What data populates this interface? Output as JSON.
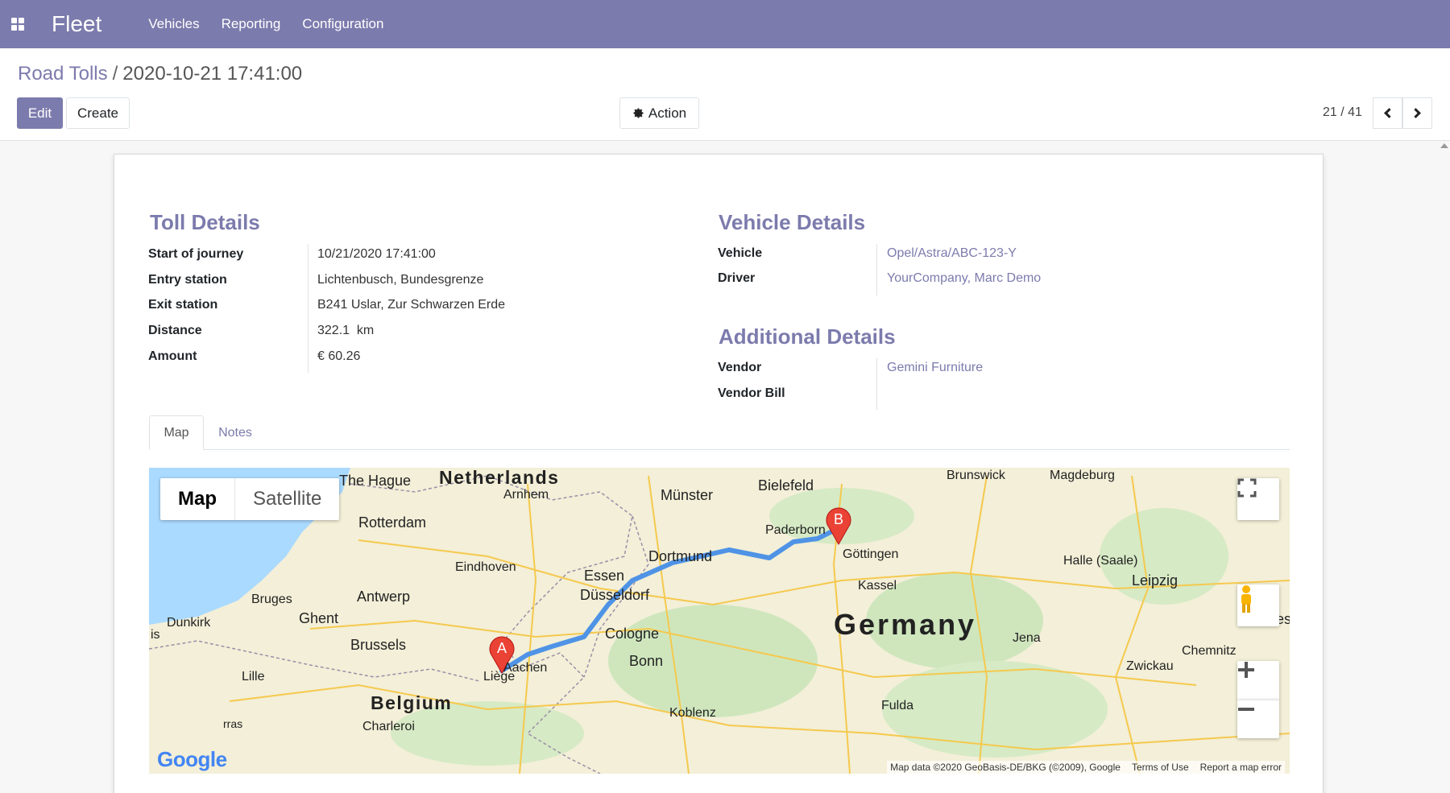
{
  "navbar": {
    "app_name": "Fleet",
    "menu": [
      "Vehicles",
      "Reporting",
      "Configuration"
    ],
    "color": "#7c7bad"
  },
  "breadcrumb": {
    "parent": "Road Tolls",
    "separator": "/",
    "current": "2020-10-21 17:41:00"
  },
  "toolbar": {
    "edit_label": "Edit",
    "create_label": "Create",
    "action_label": "Action"
  },
  "pager": {
    "value": "21 / 41"
  },
  "toll_details": {
    "title": "Toll Details",
    "fields": [
      {
        "label": "Start of journey",
        "value": "10/21/2020 17:41:00"
      },
      {
        "label": "Entry station",
        "value": "Lichtenbusch, Bundesgrenze"
      },
      {
        "label": "Exit station",
        "value": "B241 Uslar, Zur Schwarzen Erde"
      },
      {
        "label": "Distance",
        "value": "322.1  km"
      },
      {
        "label": "Amount",
        "value": "€ 60.26"
      }
    ]
  },
  "vehicle_details": {
    "title": "Vehicle Details",
    "fields": [
      {
        "label": "Vehicle",
        "value": "Opel/Astra/ABC-123-Y"
      },
      {
        "label": "Driver",
        "value": "YourCompany, Marc Demo"
      }
    ]
  },
  "additional_details": {
    "title": "Additional Details",
    "fields": [
      {
        "label": "Vendor",
        "value": "Gemini Furniture"
      },
      {
        "label": "Vendor Bill",
        "value": ""
      }
    ]
  },
  "tabs": [
    "Map",
    "Notes"
  ],
  "map": {
    "type_map": "Map",
    "type_satellite": "Satellite",
    "marker_start": "A",
    "marker_end": "B",
    "logo": "Google",
    "attribution": "Map data ©2020 GeoBasis-DE/BKG (©2009), Google",
    "terms": "Terms of Use",
    "report": "Report a map error",
    "countries": [
      "Netherlands",
      "Germany",
      "Belgium"
    ],
    "cities": [
      "The Hague",
      "Arnhem",
      "Rotterdam",
      "Münster",
      "Bielefeld",
      "Brunswick",
      "Magdeburg",
      "Paderborn",
      "Göttingen",
      "Dortmund",
      "Essen",
      "Eindhoven",
      "Düsseldorf",
      "Kassel",
      "Halle (Saale)",
      "Leipzig",
      "Bruges",
      "Antwerp",
      "Ghent",
      "Dunkirk",
      "Brussels",
      "Cologne",
      "Bonn",
      "Aachen",
      "Liège",
      "Jena",
      "Chemnitz",
      "Zwickau",
      "Lille",
      "Koblenz",
      "Fulda",
      "Charleroi",
      "Dres",
      "is",
      "rras"
    ],
    "route_color": "#4f93e6",
    "marker_color": "#ea4335"
  }
}
